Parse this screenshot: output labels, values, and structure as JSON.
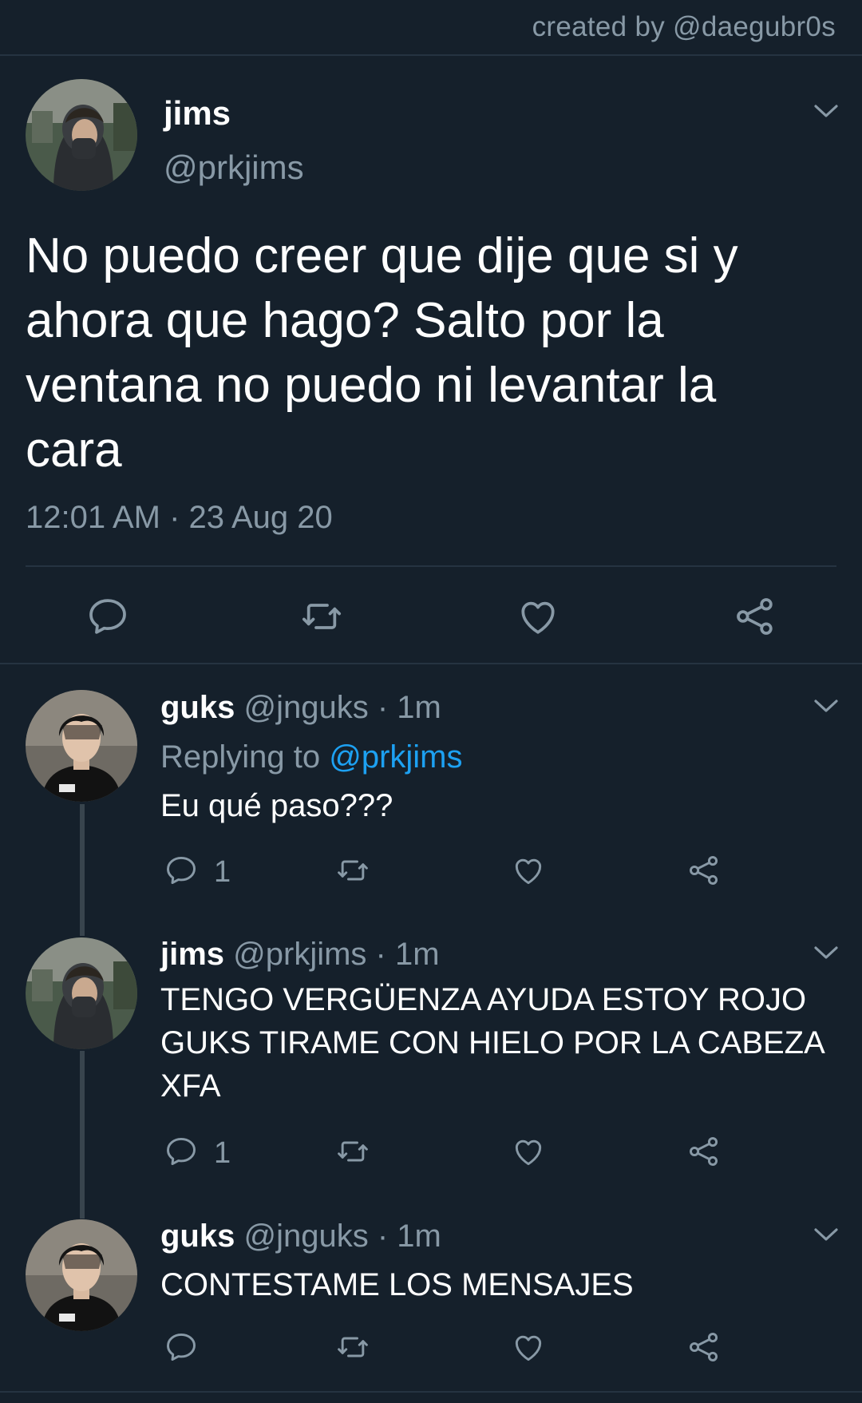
{
  "credit": "created by @daegubr0s",
  "main": {
    "name": "jims",
    "handle": "@prkjims",
    "text": "No puedo creer que dije que si y ahora que hago? Salto por la ventana no puedo ni levantar la cara",
    "time": "12:01 AM · 23 Aug 20"
  },
  "replies": [
    {
      "name": "guks",
      "meta": " @jnguks · 1m",
      "replying_label": "Replying to ",
      "replying_handle": "@prkjims",
      "text": "Eu qué paso???",
      "reply_count": "1"
    },
    {
      "name": "jims",
      "meta": " @prkjims · 1m",
      "text": "TENGO VERGÜENZA AYUDA ESTOY ROJO GUKS TIRAME CON HIELO POR LA CABEZA XFA",
      "reply_count": "1"
    },
    {
      "name": "guks",
      "meta": " @jnguks · 1m",
      "text": "CONTESTAME LOS MENSAJES"
    }
  ],
  "icons": [
    "reply-icon",
    "retweet-icon",
    "like-icon",
    "share-icon",
    "chevron-down-icon"
  ],
  "colors": {
    "background": "#15202b",
    "muted": "#8899a6",
    "link": "#1da1f2",
    "divider": "#253341"
  }
}
